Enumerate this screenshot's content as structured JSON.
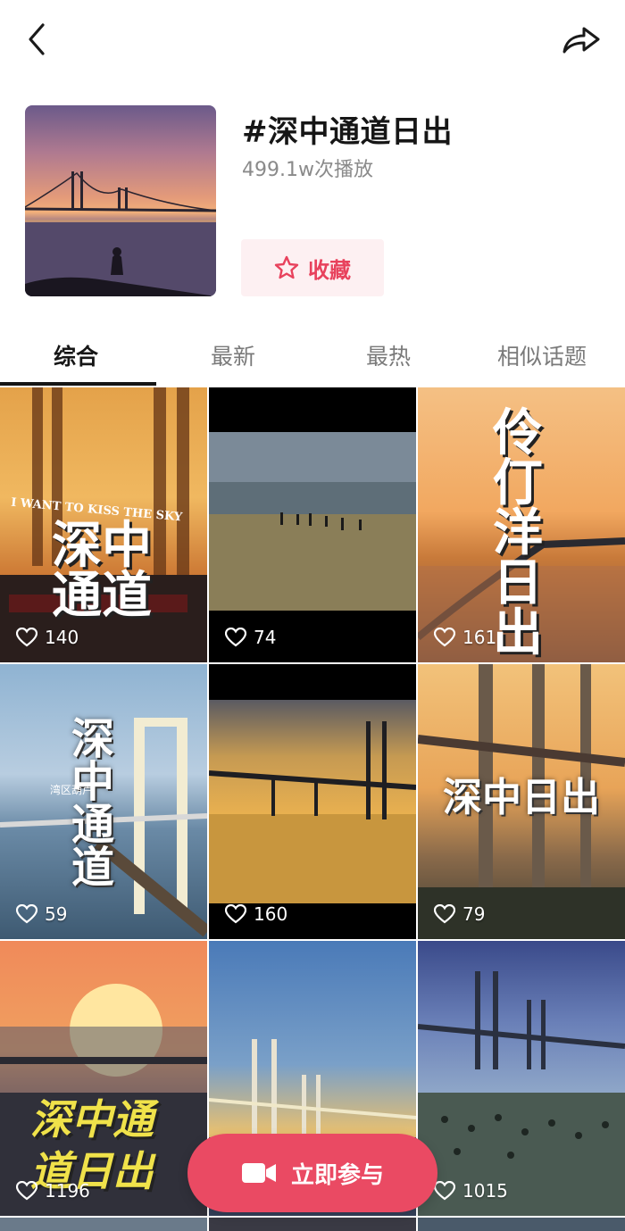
{
  "topbar": {
    "back_icon": "chevron-left-icon",
    "share_icon": "share-arrow-icon"
  },
  "topic": {
    "title": "#深中通道日出",
    "plays": "499.1w次播放",
    "favorite_label": "收藏"
  },
  "tabs": [
    {
      "label": "综合",
      "active": true
    },
    {
      "label": "最新",
      "active": false
    },
    {
      "label": "最热",
      "active": false
    },
    {
      "label": "相似话题",
      "active": false
    }
  ],
  "videos": [
    {
      "likes": "140",
      "caption": "深中通道",
      "sub_caption": "I WANT TO KISS THE SKY"
    },
    {
      "likes": "74"
    },
    {
      "likes": "161",
      "caption": "伶仃洋日出"
    },
    {
      "likes": "59",
      "caption": "深中通道",
      "sub_caption": "湾区葫芦"
    },
    {
      "likes": "160"
    },
    {
      "likes": "79",
      "caption": "深中日出"
    },
    {
      "likes": "1196",
      "caption": "深中通道日出"
    },
    {
      "likes": ""
    },
    {
      "likes": "1015"
    }
  ],
  "join_button": {
    "label": "立即参与",
    "icon": "video-camera-icon"
  },
  "colors": {
    "accent": "#ea4a63",
    "favorite_bg": "#fdf0f2",
    "favorite_text": "#e8425d"
  }
}
